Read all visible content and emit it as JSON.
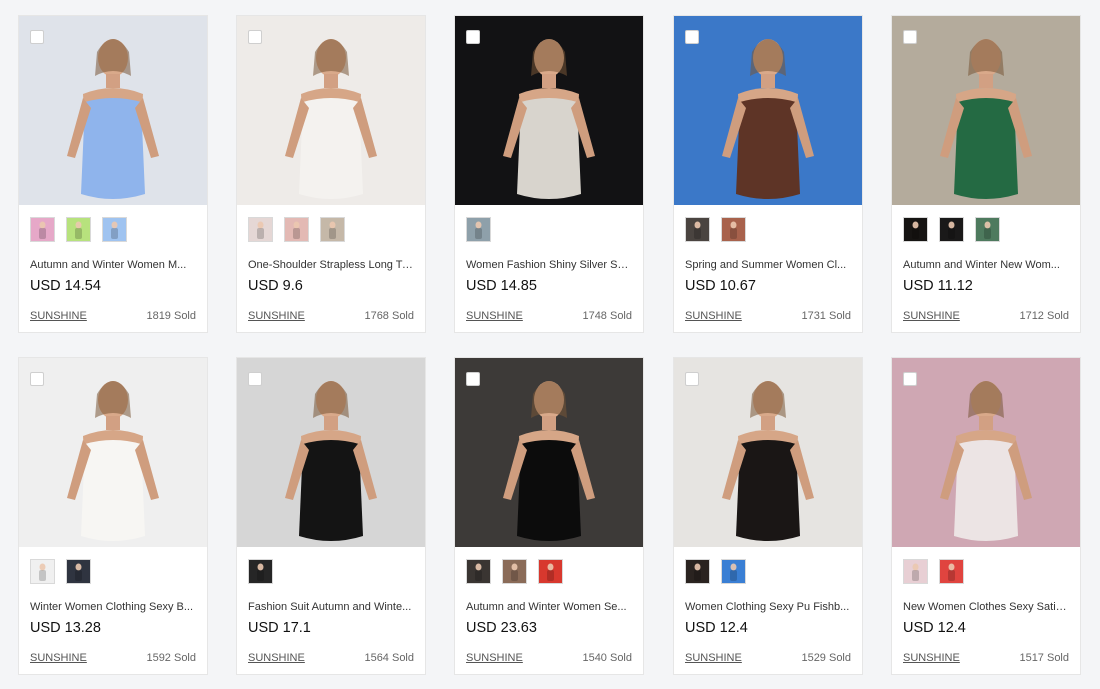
{
  "products": [
    {
      "title": "Autumn and Winter Women M...",
      "price": "USD 14.54",
      "shop": "SUNSHINE",
      "sold": "1819 Sold",
      "bg": "#dfe3ea",
      "accent": "#8fb4ec",
      "swatches": [
        "#e6a8c8",
        "#b7e27d",
        "#9fc3f0"
      ]
    },
    {
      "title": "One-Shoulder Strapless Long Ty...",
      "price": "USD 9.6",
      "shop": "SUNSHINE",
      "sold": "1768 Sold",
      "bg": "#eeebe8",
      "accent": "#f4f2ef",
      "swatches": [
        "#e5d7d5",
        "#e3b9b4",
        "#c5b8a8"
      ]
    },
    {
      "title": "Women Fashion Shiny Silver Su...",
      "price": "USD 14.85",
      "shop": "SUNSHINE",
      "sold": "1748 Sold",
      "bg": "#121214",
      "accent": "#d8d4cd",
      "swatches": [
        "#8ea0aa"
      ]
    },
    {
      "title": "Spring and Summer Women Cl...",
      "price": "USD 10.67",
      "shop": "SUNSHINE",
      "sold": "1731 Sold",
      "bg": "#3b78c8",
      "accent": "#5e3426",
      "swatches": [
        "#4a4440",
        "#a8624c"
      ]
    },
    {
      "title": "Autumn and Winter New Wom...",
      "price": "USD 11.12",
      "shop": "SUNSHINE",
      "sold": "1712 Sold",
      "bg": "#b4ab9c",
      "accent": "#246a43",
      "swatches": [
        "#161412",
        "#1a1919",
        "#4e7a5e"
      ]
    },
    {
      "title": "Winter Women Clothing Sexy B...",
      "price": "USD 13.28",
      "shop": "SUNSHINE",
      "sold": "1592 Sold",
      "bg": "#efefef",
      "accent": "#f7f6f3",
      "swatches": [
        "#f0f0f0",
        "#2f3440"
      ]
    },
    {
      "title": "Fashion Suit Autumn and Winte...",
      "price": "USD 17.1",
      "shop": "SUNSHINE",
      "sold": "1564 Sold",
      "bg": "#d6d6d6",
      "accent": "#141414",
      "swatches": [
        "#262626"
      ]
    },
    {
      "title": "Autumn and Winter Women Se...",
      "price": "USD 23.63",
      "shop": "SUNSHINE",
      "sold": "1540 Sold",
      "bg": "#3d3a38",
      "accent": "#0c0c0c",
      "swatches": [
        "#3a3532",
        "#8a6b58",
        "#d8382e"
      ]
    },
    {
      "title": "Women Clothing Sexy Pu Fishb...",
      "price": "USD 12.4",
      "shop": "SUNSHINE",
      "sold": "1529 Sold",
      "bg": "#e6e4e1",
      "accent": "#1a1615",
      "swatches": [
        "#2a2320",
        "#3a7fd4"
      ]
    },
    {
      "title": "New Women Clothes Sexy Satin...",
      "price": "USD 12.4",
      "shop": "SUNSHINE",
      "sold": "1517 Sold",
      "bg": "#cfa7b3",
      "accent": "#ece4e4",
      "swatches": [
        "#e8cfd4",
        "#e0443f"
      ]
    }
  ]
}
